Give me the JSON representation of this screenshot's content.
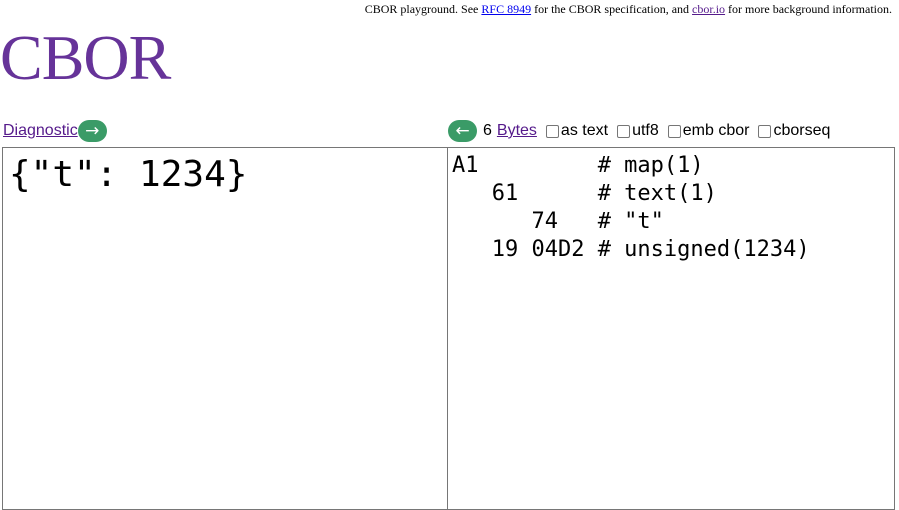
{
  "header": {
    "note_prefix": "CBOR playground. See ",
    "rfc_link": "RFC 8949",
    "note_middle": " for the CBOR specification, and ",
    "cborio_link": "cbor.io",
    "note_suffix": " for more background information.",
    "logo": "CBOR"
  },
  "left": {
    "link_label": "Diagnostic",
    "arrow": "→",
    "content": "{\"t\": 1234}"
  },
  "right": {
    "arrow": "←",
    "byte_count": "6",
    "link_label": "Bytes",
    "options": [
      {
        "label": "as text",
        "checked": false
      },
      {
        "label": "utf8",
        "checked": false
      },
      {
        "label": "emb cbor",
        "checked": false
      },
      {
        "label": "cborseq",
        "checked": false
      }
    ],
    "hex_lines": [
      "A1         # map(1)",
      "   61      # text(1)",
      "      74   # \"t\"",
      "   19 04D2 # unsigned(1234)"
    ]
  }
}
